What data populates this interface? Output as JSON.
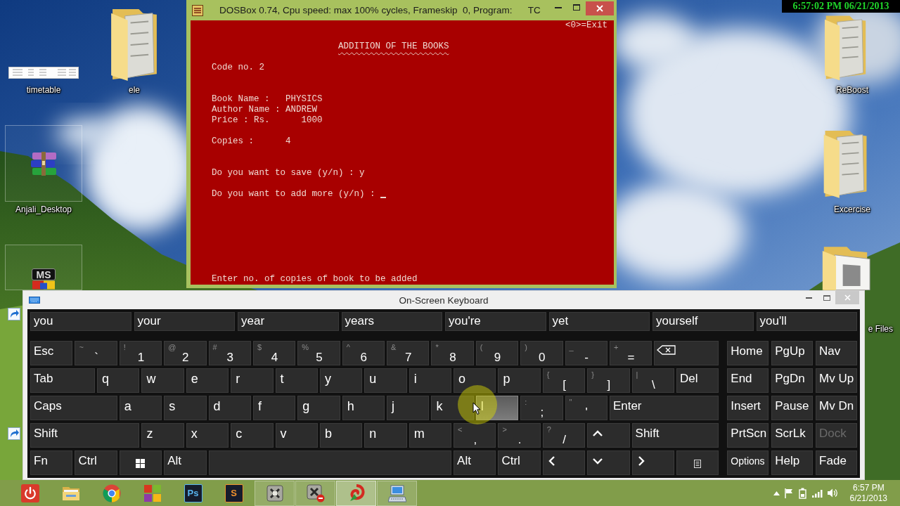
{
  "desktop": {
    "icons": [
      {
        "label": "timetable",
        "kind": "sheet",
        "highlighted": false
      },
      {
        "label": "ele",
        "kind": "folder",
        "highlighted": false
      },
      {
        "label": "Anjali_Desktop",
        "kind": "archive",
        "highlighted": true
      },
      {
        "kind": "lettered",
        "lettering": "MS",
        "highlighted": true
      },
      {
        "label": "ReBoost",
        "kind": "folder",
        "highlighted": false
      },
      {
        "label": "Excercise",
        "kind": "folder",
        "highlighted": false
      },
      {
        "label": "e Files",
        "kind": "open-folder",
        "highlighted": false
      }
    ]
  },
  "recording_stamp": "6:57:02 PM 06/21/2013",
  "dosbox": {
    "title": "DOSBox 0.74, Cpu speed: max 100% cycles, Frameskip  0, Program:      TC",
    "screen": {
      "exit_hint": "<0>=Exit",
      "heading": "ADDITION OF THE BOOKS",
      "code_line": "Code no. 2",
      "details": [
        "Book Name :   PHYSICS",
        "Author Name : ANDREW",
        "Price : Rs.      1000"
      ],
      "copies_line": "Copies :      4",
      "prompts": [
        {
          "text": "Do you want to save (y/n) : y",
          "cursor": false
        },
        {
          "text": "Do you want to add more (y/n) :",
          "cursor": true
        }
      ],
      "status_line": "Enter no. of copies of book to be added"
    }
  },
  "keyboard": {
    "title": "On-Screen Keyboard",
    "predictions": [
      "you",
      "your",
      "year",
      "years",
      "you're",
      "yet",
      "yourself",
      "you'll"
    ],
    "rows": [
      [
        {
          "kind": "command",
          "label": "Esc",
          "hovered": false
        },
        {
          "kind": "symbol",
          "label": "`",
          "shift": "~",
          "hovered": false
        },
        {
          "kind": "symbol",
          "label": "1",
          "shift": "!",
          "hovered": false
        },
        {
          "kind": "symbol",
          "label": "2",
          "shift": "@",
          "hovered": false
        },
        {
          "kind": "symbol",
          "label": "3",
          "shift": "#",
          "hovered": false
        },
        {
          "kind": "symbol",
          "label": "4",
          "shift": "$",
          "hovered": false
        },
        {
          "kind": "symbol",
          "label": "5",
          "shift": "%",
          "hovered": false
        },
        {
          "kind": "symbol",
          "label": "6",
          "shift": "^",
          "hovered": false
        },
        {
          "kind": "symbol",
          "label": "7",
          "shift": "&",
          "hovered": false
        },
        {
          "kind": "symbol",
          "label": "8",
          "shift": "*",
          "hovered": false
        },
        {
          "kind": "symbol",
          "label": "9",
          "shift": "(",
          "hovered": false
        },
        {
          "kind": "symbol",
          "label": "0",
          "shift": ")",
          "hovered": false
        },
        {
          "kind": "symbol",
          "label": "-",
          "shift": "_",
          "hovered": false
        },
        {
          "kind": "symbol",
          "label": "=",
          "shift": "+",
          "hovered": false
        },
        {
          "kind": "backspace",
          "hovered": false
        }
      ],
      [
        {
          "kind": "command",
          "label": "Tab",
          "hovered": false
        },
        {
          "kind": "letter",
          "label": "q",
          "hovered": false
        },
        {
          "kind": "letter",
          "label": "w",
          "hovered": false
        },
        {
          "kind": "letter",
          "label": "e",
          "hovered": false
        },
        {
          "kind": "letter",
          "label": "r",
          "hovered": false
        },
        {
          "kind": "letter",
          "label": "t",
          "hovered": false
        },
        {
          "kind": "letter",
          "label": "y",
          "hovered": false
        },
        {
          "kind": "letter",
          "label": "u",
          "hovered": false
        },
        {
          "kind": "letter",
          "label": "i",
          "hovered": false
        },
        {
          "kind": "letter",
          "label": "o",
          "hovered": false
        },
        {
          "kind": "letter",
          "label": "p",
          "hovered": false
        },
        {
          "kind": "symbol",
          "label": "[",
          "shift": "{",
          "hovered": false
        },
        {
          "kind": "symbol",
          "label": "]",
          "shift": "}",
          "hovered": false
        },
        {
          "kind": "symbol",
          "label": "\\",
          "shift": "|",
          "hovered": false
        },
        {
          "kind": "command",
          "label": "Del",
          "hovered": false
        }
      ],
      [
        {
          "kind": "command",
          "label": "Caps",
          "hovered": false
        },
        {
          "kind": "letter",
          "label": "a",
          "hovered": false
        },
        {
          "kind": "letter",
          "label": "s",
          "hovered": false
        },
        {
          "kind": "letter",
          "label": "d",
          "hovered": false
        },
        {
          "kind": "letter",
          "label": "f",
          "hovered": false
        },
        {
          "kind": "letter",
          "label": "g",
          "hovered": false
        },
        {
          "kind": "letter",
          "label": "h",
          "hovered": false
        },
        {
          "kind": "letter",
          "label": "j",
          "hovered": false
        },
        {
          "kind": "letter",
          "label": "k",
          "hovered": false
        },
        {
          "kind": "letter",
          "label": "l",
          "hovered": true
        },
        {
          "kind": "symbol",
          "label": ";",
          "shift": ":",
          "hovered": false
        },
        {
          "kind": "symbol",
          "label": "'",
          "shift": "\"",
          "hovered": false
        },
        {
          "kind": "command",
          "label": "Enter",
          "hovered": false
        }
      ],
      [
        {
          "kind": "command",
          "label": "Shift",
          "hovered": false
        },
        {
          "kind": "letter",
          "label": "z",
          "hovered": false
        },
        {
          "kind": "letter",
          "label": "x",
          "hovered": false
        },
        {
          "kind": "letter",
          "label": "c",
          "hovered": false
        },
        {
          "kind": "letter",
          "label": "v",
          "hovered": false
        },
        {
          "kind": "letter",
          "label": "b",
          "hovered": false
        },
        {
          "kind": "letter",
          "label": "n",
          "hovered": false
        },
        {
          "kind": "letter",
          "label": "m",
          "hovered": false
        },
        {
          "kind": "symbol",
          "label": ",",
          "shift": "<",
          "hovered": false
        },
        {
          "kind": "symbol",
          "label": ".",
          "shift": ">",
          "hovered": false
        },
        {
          "kind": "symbol",
          "label": "/",
          "shift": "?",
          "hovered": false
        },
        {
          "kind": "arrow-up",
          "hovered": false
        },
        {
          "kind": "command",
          "label": "Shift",
          "hovered": false
        }
      ],
      [
        {
          "kind": "command",
          "label": "Fn",
          "hovered": false
        },
        {
          "kind": "command",
          "label": "Ctrl",
          "hovered": false
        },
        {
          "kind": "windows",
          "hovered": false
        },
        {
          "kind": "command",
          "label": "Alt",
          "hovered": false
        },
        {
          "kind": "space",
          "hovered": false
        },
        {
          "kind": "command",
          "label": "Alt",
          "hovered": false
        },
        {
          "kind": "command",
          "label": "Ctrl",
          "hovered": false
        },
        {
          "kind": "arrow-left",
          "hovered": false
        },
        {
          "kind": "arrow-down",
          "hovered": false
        },
        {
          "kind": "arrow-right",
          "hovered": false
        },
        {
          "kind": "menu",
          "hovered": false
        }
      ]
    ],
    "nav_rows": [
      [
        {
          "kind": "command",
          "label": "Home",
          "disabled": false
        },
        {
          "kind": "command",
          "label": "PgUp",
          "disabled": false
        },
        {
          "kind": "command",
          "label": "Nav",
          "disabled": false
        }
      ],
      [
        {
          "kind": "command",
          "label": "End",
          "disabled": false
        },
        {
          "kind": "command",
          "label": "PgDn",
          "disabled": false
        },
        {
          "kind": "command",
          "label": "Mv Up",
          "disabled": false
        }
      ],
      [
        {
          "kind": "command",
          "label": "Insert",
          "disabled": false
        },
        {
          "kind": "command",
          "label": "Pause",
          "disabled": false
        },
        {
          "kind": "command",
          "label": "Mv Dn",
          "disabled": false
        }
      ],
      [
        {
          "kind": "command",
          "label": "PrtScn",
          "disabled": false
        },
        {
          "kind": "command",
          "label": "ScrLk",
          "disabled": false
        },
        {
          "kind": "command",
          "label": "Dock",
          "disabled": true
        }
      ],
      [
        {
          "kind": "compact",
          "label": "Options",
          "disabled": false
        },
        {
          "kind": "command",
          "label": "Help",
          "disabled": false
        },
        {
          "kind": "command",
          "label": "Fade",
          "disabled": false
        }
      ]
    ]
  },
  "taskbar": {
    "apps": [
      {
        "kind": "power",
        "running": false,
        "active": false
      },
      {
        "kind": "folder",
        "running": false,
        "active": false
      },
      {
        "kind": "wheel",
        "running": false,
        "active": false
      },
      {
        "kind": "tiles",
        "running": false,
        "active": false
      },
      {
        "kind": "lettered",
        "lettering": "Ps",
        "color": "#58b4f0",
        "running": false,
        "active": false
      },
      {
        "kind": "lettered",
        "lettering": "S",
        "color": "#f0922e",
        "running": false,
        "active": false
      },
      {
        "kind": "program",
        "running": true,
        "active": false
      },
      {
        "kind": "program-badge",
        "running": true,
        "active": false
      },
      {
        "kind": "swirl",
        "running": true,
        "active": true
      },
      {
        "kind": "keyboard",
        "running": true,
        "active": false
      }
    ],
    "clock": {
      "time": "6:57 PM",
      "date": "6/21/2013"
    }
  }
}
